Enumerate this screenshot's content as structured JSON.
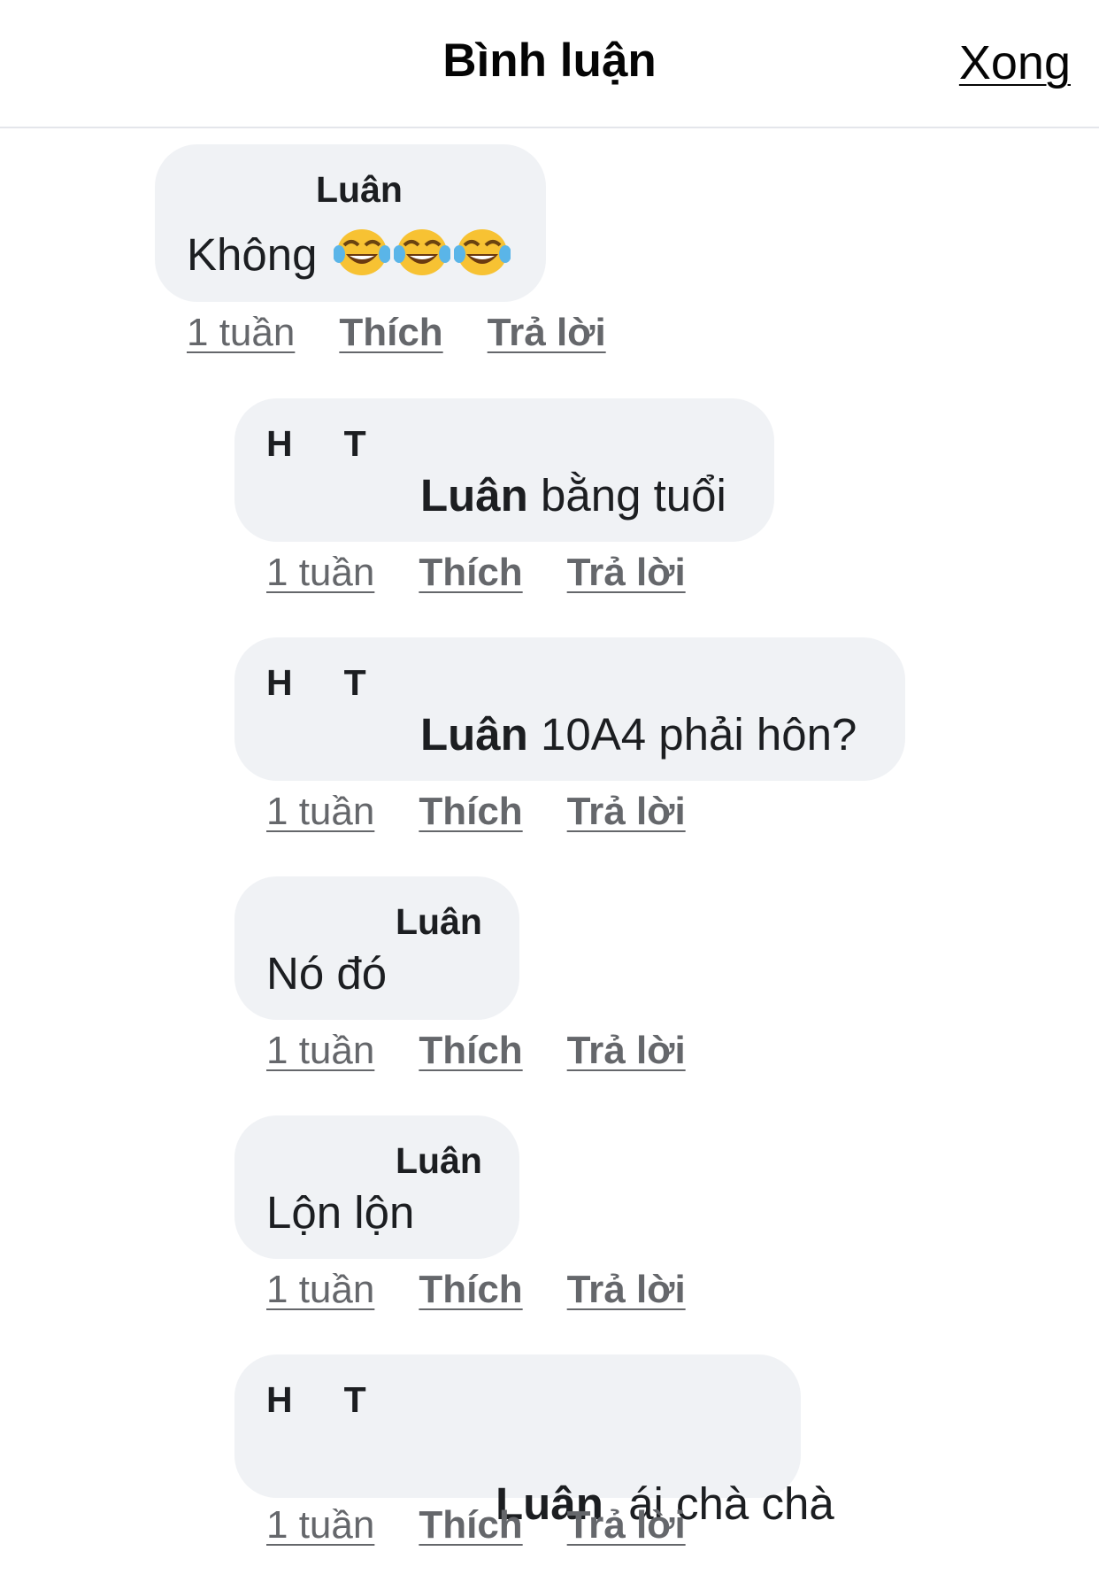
{
  "header": {
    "title": "Bình luận",
    "done_label": "Xong"
  },
  "comments": [
    {
      "author": "Luân",
      "text": "Không",
      "emoji": [
        "face-with-tears-of-joy-icon",
        "face-with-tears-of-joy-icon",
        "face-with-tears-of-joy-icon"
      ],
      "time": "1 tuần",
      "like": "Thích",
      "reply": "Trả lời"
    },
    {
      "author_initials": [
        "H",
        "T"
      ],
      "mention": "Luân",
      "text": " bằng tuổi",
      "time": "1 tuần",
      "like": "Thích",
      "reply": "Trả lời"
    },
    {
      "author_initials": [
        "H",
        "T"
      ],
      "mention": "Luân",
      "text": " 10A4 phải hôn?",
      "time": "1 tuần",
      "like": "Thích",
      "reply": "Trả lời"
    },
    {
      "author": "Luân",
      "text": "Nó đó",
      "time": "1 tuần",
      "like": "Thích",
      "reply": "Trả lời"
    },
    {
      "author": "Luân",
      "text": "Lộn lộn",
      "time": "1 tuần",
      "like": "Thích",
      "reply": "Trả lời"
    },
    {
      "author_initials": [
        "H",
        "T"
      ],
      "mention": "Luân",
      "text": "  ái chà chà",
      "time": "1 tuần",
      "like": "Thích",
      "reply": "Trả lời"
    }
  ]
}
